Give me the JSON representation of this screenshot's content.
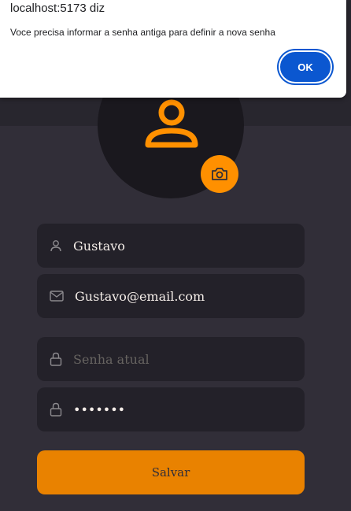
{
  "dialog": {
    "title": "localhost:5173 diz",
    "message": "Voce precisa informar a senha antiga para definir a nova senha",
    "ok_label": "OK"
  },
  "profile": {
    "avatar_icon": "user-icon",
    "camera_icon": "camera-icon"
  },
  "form": {
    "name": {
      "icon": "user-icon",
      "value": "Gustavo"
    },
    "email": {
      "icon": "mail-icon",
      "value": "Gustavo@email.com"
    },
    "old_password": {
      "icon": "lock-icon",
      "placeholder": "Senha atual",
      "value": ""
    },
    "new_password": {
      "icon": "lock-icon",
      "value": "•••••••"
    },
    "save_label": "Salvar"
  },
  "colors": {
    "accent": "#ff9000",
    "background": "#312e38",
    "input_background": "#232129",
    "dialog_button": "#0b57d0"
  }
}
